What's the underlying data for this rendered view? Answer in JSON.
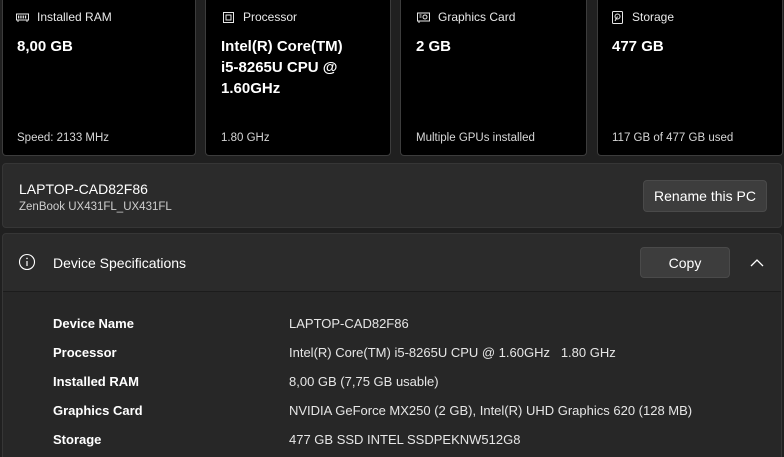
{
  "cards": [
    {
      "icon": "ram-icon",
      "title": "Installed RAM",
      "value": "8,00 GB",
      "sub": "Speed: 2133 MHz"
    },
    {
      "icon": "processor-icon",
      "title": "Processor",
      "value": "Intel(R) Core(TM)\ni5-8265U CPU @\n1.60GHz",
      "sub": "1.80 GHz"
    },
    {
      "icon": "graphics-card-icon",
      "title": "Graphics Card",
      "value": "2 GB",
      "sub": "Multiple GPUs installed"
    },
    {
      "icon": "storage-icon",
      "title": "Storage",
      "value": "477 GB",
      "sub": "117 GB of 477 GB used"
    }
  ],
  "pc": {
    "name": "LAPTOP-CAD82F86",
    "model": "ZenBook UX431FL_UX431FL",
    "rename_label": "Rename this PC"
  },
  "specs": {
    "icon": "info-icon",
    "title": "Device Specifications",
    "copy_label": "Copy",
    "rows": [
      {
        "label": "Device Name",
        "value": "LAPTOP-CAD82F86"
      },
      {
        "label": "Processor",
        "value": "Intel(R) Core(TM) i5-8265U CPU @ 1.60GHz   1.80 GHz"
      },
      {
        "label": "Installed RAM",
        "value": "8,00 GB (7,75 GB usable)"
      },
      {
        "label": "Graphics Card",
        "value": "NVIDIA GeForce MX250 (2 GB), Intel(R) UHD Graphics 620 (128 MB)"
      },
      {
        "label": "Storage",
        "value": "477 GB SSD INTEL SSDPEKNW512G8"
      }
    ]
  },
  "colors": {
    "background": "#202020",
    "card_background": "#000000",
    "panel_background": "#2b2b2b",
    "button_background": "#3d3d3d"
  }
}
